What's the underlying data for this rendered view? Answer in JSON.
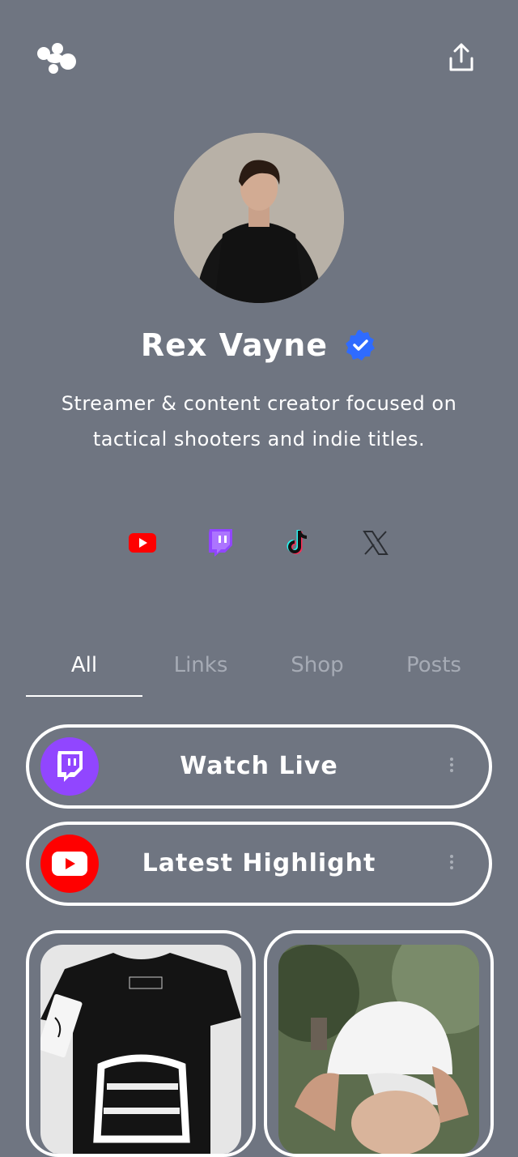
{
  "profile": {
    "name": "Rex Vayne",
    "bio": "Streamer & content creator focused on tactical shooters and indie titles."
  },
  "icons": {
    "logo": "linktree-style-logo-icon",
    "share": "share-upload-icon",
    "verified": "verified-badge-icon",
    "youtube": "youtube-icon",
    "twitch": "twitch-icon",
    "tiktok": "tiktok-icon",
    "x": "x-icon"
  },
  "colors": {
    "background": "#6f7581",
    "twitch": "#9146ff",
    "youtube": "#ff0000",
    "verified": "#2f6bff"
  },
  "tabs": [
    {
      "label": "All",
      "active": true
    },
    {
      "label": "Links",
      "active": false
    },
    {
      "label": "Shop",
      "active": false
    },
    {
      "label": "Posts",
      "active": false
    }
  ],
  "links": [
    {
      "label": "Watch Live",
      "icon": "twitch-icon"
    },
    {
      "label": "Latest Highlight",
      "icon": "youtube-icon"
    }
  ],
  "shop": [
    {
      "item": "black-tshirt-image"
    },
    {
      "item": "white-cap-image"
    }
  ]
}
